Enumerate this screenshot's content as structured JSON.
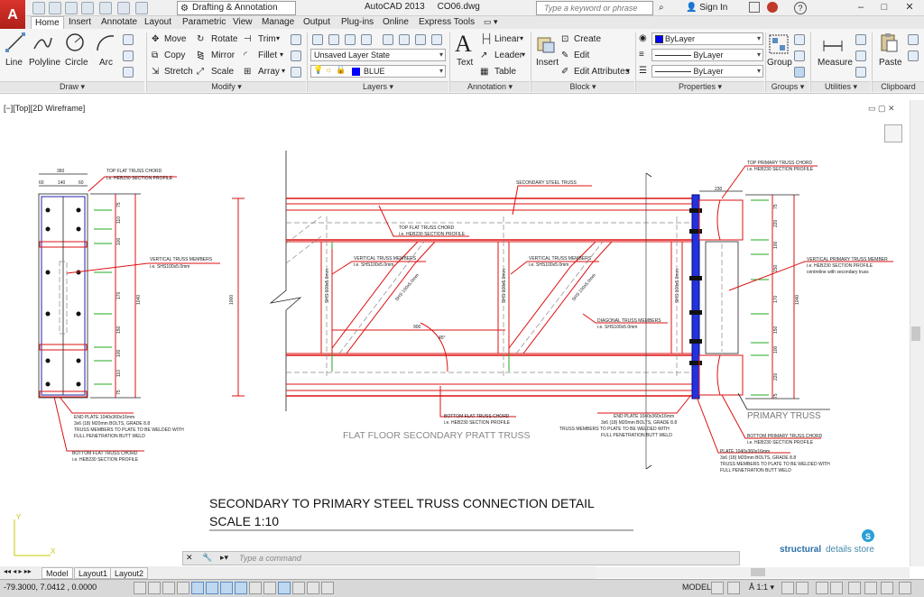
{
  "titlebar": {
    "workspace": "Drafting & Annotation",
    "app_name": "AutoCAD 2013",
    "file_name": "CO06.dwg",
    "search_placeholder": "Type a keyword or phrase",
    "sign_in": "Sign In"
  },
  "tabs": [
    "Home",
    "Insert",
    "Annotate",
    "Layout",
    "Parametric",
    "View",
    "Manage",
    "Output",
    "Plug-ins",
    "Online",
    "Express Tools"
  ],
  "ribbon": {
    "draw": {
      "title": "Draw",
      "items": [
        "Line",
        "Polyline",
        "Circle",
        "Arc"
      ]
    },
    "modify": {
      "title": "Modify",
      "items": [
        "Move",
        "Rotate",
        "Trim",
        "Copy",
        "Mirror",
        "Fillet",
        "Stretch",
        "Scale",
        "Array"
      ]
    },
    "layers": {
      "title": "Layers",
      "layer_state": "Unsaved Layer State",
      "current_layer": "BLUE"
    },
    "annotation": {
      "title": "Annotation",
      "items": [
        "Text",
        "Linear",
        "Leader",
        "Table"
      ]
    },
    "block": {
      "title": "Block",
      "items": [
        "Insert",
        "Create",
        "Edit",
        "Edit Attributes"
      ]
    },
    "properties": {
      "title": "Properties",
      "color": "ByLayer",
      "linetype": "ByLayer",
      "lineweight": "ByLayer"
    },
    "groups": {
      "title": "Groups",
      "items": [
        "Group"
      ]
    },
    "utilities": {
      "title": "Utilities",
      "items": [
        "Measure"
      ]
    },
    "clipboard": {
      "title": "Clipboard",
      "items": [
        "Paste"
      ]
    }
  },
  "viewport_label": "[−][Top][2D Wireframe]",
  "drawing": {
    "title": "SECONDARY TO PRIMARY STEEL TRUSS CONNECTION DETAIL",
    "scale": "SCALE 1:10",
    "brand_a": "structural",
    "brand_b": "details store",
    "brand_icon": "S",
    "left_detail": {
      "dim_total": "360",
      "dim_a": "60",
      "dim_b": "140",
      "dim_c": "60",
      "top_chord_title": "TOP FLAT TRUSS CHORD",
      "top_chord_profile": "i.e. HEB230 SECTION PROFILE",
      "vertical_title": "VERTICAL TRUSS MEMBERS",
      "vertical_profile": "i.e. SHS100x5.0mm",
      "end_plate_1": "END PLATE 1040x360x16mm",
      "end_plate_2": "3x6 (18) M20mm BOLTS, GRADE 8.8",
      "end_plate_3": "TRUSS MEMBERS TO PLATE TO BE WELDED WITH",
      "end_plate_4": "FULL PENETRATION BUTT WELD",
      "bottom_chord_title": "BOTTOM FLAT TRUSS CHORD",
      "bottom_chord_profile": "i.e. HEB230 SECTION PROFILE",
      "dims_v": [
        "75",
        "110",
        "100",
        "170",
        "150",
        "100",
        "110",
        "75"
      ],
      "total_h": "1040"
    },
    "middle": {
      "secondary_truss": "SECONDARY STEEL TRUSS",
      "top_chord_title": "TOP FLAT TRUSS CHORD",
      "top_chord_profile": "i.e. HEB230 SECTION PROFILE",
      "vertical_title_1": "VERTICAL TRUSS MEMBERS",
      "vertical_profile_1": "i.e. SHS100x5.0mm",
      "vertical_title_2": "VERTICAL TRUSS MEMBERS",
      "vertical_profile_2": "i.e. SHS100x5.0mm",
      "diagonal_title": "DIAGONAL TRUSS MEMBERS",
      "diagonal_profile": "i.e. SHS100x5.0mm",
      "bottom_chord_title": "BOTTOM FLAT TRUSS CHORD",
      "bottom_chord_profile": "i.e. HEB230 SECTION PROFILE",
      "end_plate_1": "END PLATE 1040x360x16mm",
      "end_plate_2": "3x6 (18) M20mm BOLTS, GRADE 8.8",
      "end_plate_3": "TRUSS MEMBERS TO PLATE TO BE WELDED WITH",
      "end_plate_4": "FULL PENETRATION BUTT WELD",
      "caption": "FLAT FLOOR SECONDARY PRATT TRUSS",
      "height_dim": "1000",
      "span_dim": "900",
      "angle_dim": "45°",
      "shs_label": "SHS 100x5.0mm"
    },
    "right_detail": {
      "dim_top": "230",
      "top_chord_title": "TOP PRIMARY TRUSS CHORD",
      "top_chord_profile": "i.e. HEB230 SECTION PROFILE",
      "vertical_title": "VERTICAL PRIMARY TRUSS MEMBER",
      "vertical_profile": "i.e. HEB230 SECTION PROFILE",
      "vertical_note": "centreline with secondary truss",
      "primary_caption": "PRIMARY TRUSS",
      "bottom_chord_title": "BOTTOM PRIMARY TRUSS CHORD",
      "bottom_chord_profile": "i.e. HEB230 SECTION PROFILE",
      "plate_1": "PLATE 1040x360x16mm",
      "plate_2": "3x6 (18) M20mm BOLTS, GRADE 8.8",
      "plate_3": "TRUSS MEMBERS TO PLATE TO BE WELDED WITH",
      "plate_4": "FULL PENETRATION BUTT WELD",
      "dims_v": [
        "75",
        "220",
        "100",
        "150",
        "170",
        "150",
        "100",
        "220",
        "75"
      ],
      "total_h": "1040"
    }
  },
  "command_placeholder": "Type a command",
  "layout_tabs": [
    "Model",
    "Layout1",
    "Layout2"
  ],
  "status": {
    "coords": "-79.3000, 7.0412 , 0.0000",
    "mode": "MODEL",
    "scale": "1:1"
  }
}
